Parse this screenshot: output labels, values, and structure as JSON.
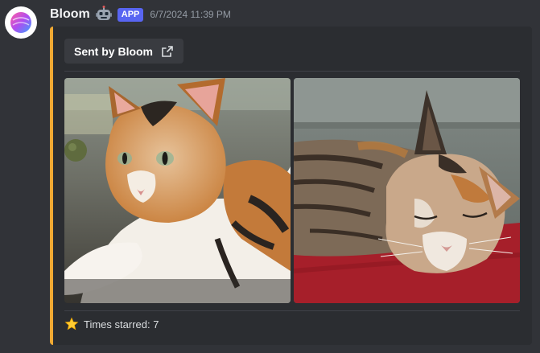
{
  "message": {
    "author": "Bloom",
    "app_tag": "APP",
    "timestamp": "6/7/2024 11:39 PM"
  },
  "embed": {
    "accent_color": "#f0a933",
    "sent_by_label": "Sent by Bloom",
    "images": [
      {
        "subject": "calico cat lying on pavement, looking left"
      },
      {
        "subject": "calico cat sleeping on red mat"
      }
    ],
    "footer_text": "Times starred: 7"
  },
  "icons": {
    "avatar": "bloom-logo-icon",
    "bot": "robot-emoji-icon",
    "external_link": "external-link-icon",
    "star": "star-emoji-icon"
  }
}
